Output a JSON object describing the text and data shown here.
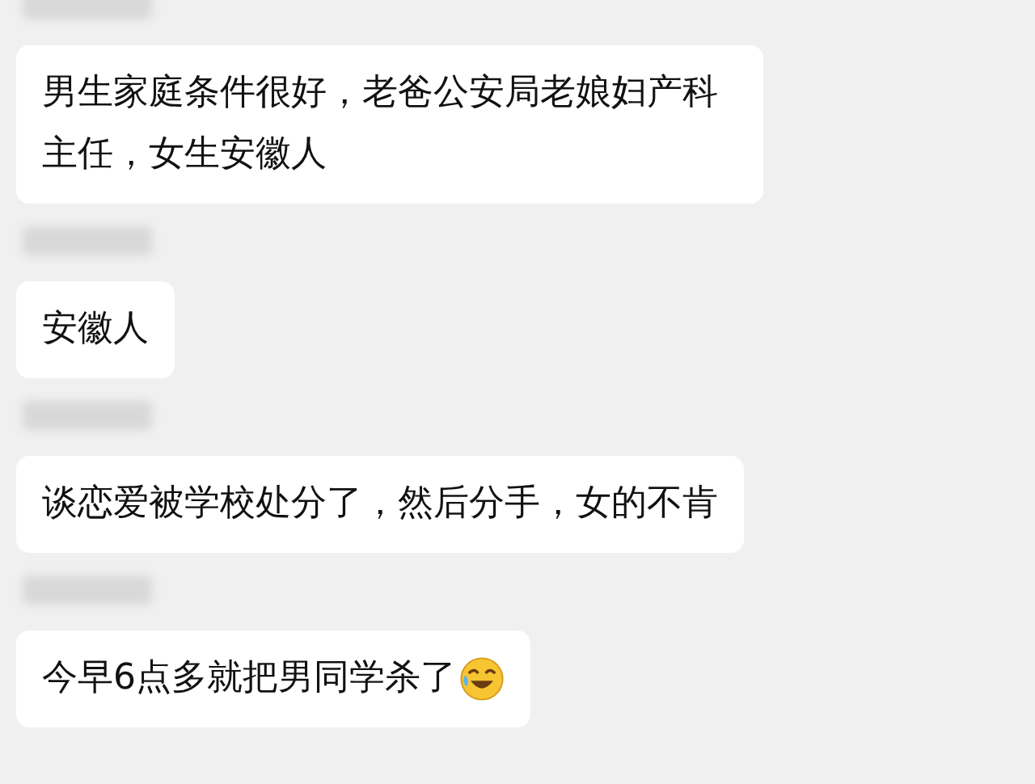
{
  "messages": [
    {
      "text": "男生家庭条件很好，老爸公安局老娘妇产科主任，女生安徽人",
      "has_emoji": false
    },
    {
      "text": "安徽人",
      "has_emoji": false
    },
    {
      "text": "谈恋爱被学校处分了，然后分手，女的不肯",
      "has_emoji": false
    },
    {
      "text": "今早6点多就把男同学杀了",
      "has_emoji": true
    }
  ]
}
